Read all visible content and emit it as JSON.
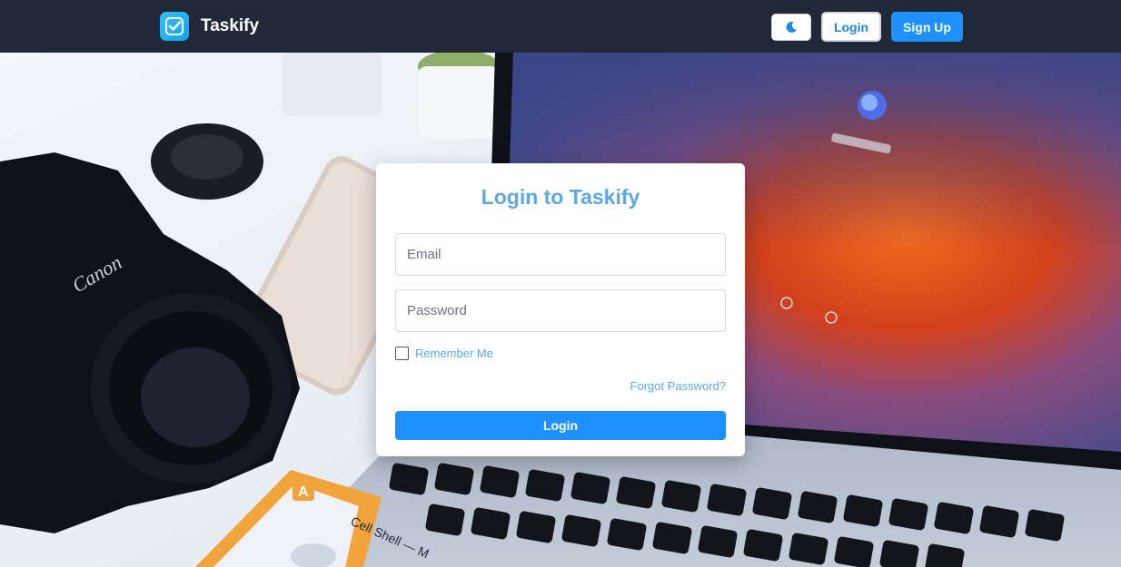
{
  "header": {
    "brand_name": "Taskify",
    "theme_toggle_icon": "moon-icon",
    "login_label": "Login",
    "signup_label": "Sign Up"
  },
  "login_card": {
    "title": "Login to Taskify",
    "email_placeholder": "Email",
    "password_placeholder": "Password",
    "remember_label": "Remember Me",
    "forgot_label": "Forgot Password?",
    "submit_label": "Login"
  },
  "background": {
    "camera_brand": "Canon",
    "cassette_letter": "A",
    "cassette_label": "Cell Shell — M"
  },
  "colors": {
    "header_bg": "#1f2937",
    "accent": "#1e90ff",
    "title_color": "#5aa9e6"
  }
}
